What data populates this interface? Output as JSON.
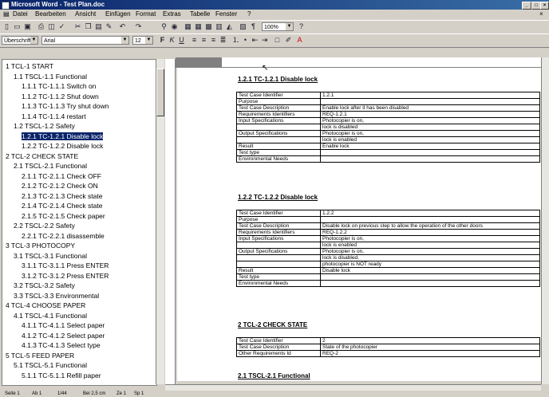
{
  "window": {
    "title": "Microsoft Word - Test Plan.doc"
  },
  "menu": [
    "Datei",
    "Bearbeiten",
    "Ansicht",
    "Einfügen",
    "Format",
    "Extras",
    "Tabelle",
    "Fenster",
    "?"
  ],
  "toolbar": {
    "style": "Überschrift",
    "font": "Arial",
    "size": "12",
    "zoom": "100%"
  },
  "docmap": [
    {
      "text": "1 TCL-1 START",
      "indent": 0
    },
    {
      "text": "1.1 TSCL-1.1 Functional",
      "indent": 1
    },
    {
      "text": "1.1.1 TC-1.1.1 Switch on",
      "indent": 2
    },
    {
      "text": "1.1.2 TC-1.1.2 Shut down",
      "indent": 2
    },
    {
      "text": "1.1.3 TC-1.1.3 Try shut down",
      "indent": 2
    },
    {
      "text": "1.1.4 TC-1.1.4 restart",
      "indent": 2
    },
    {
      "text": "1.2 TSCL-1.2 Safety",
      "indent": 1
    },
    {
      "text": "1.2.1 TC-1.2.1 Disable lock",
      "indent": 2,
      "selected": true
    },
    {
      "text": "1.2.2 TC-1.2.2 Disable lock",
      "indent": 2
    },
    {
      "text": "2 TCL-2 CHECK STATE",
      "indent": 0
    },
    {
      "text": "2.1 TSCL-2.1 Functional",
      "indent": 1
    },
    {
      "text": "2.1.1 TC-2.1.1 Check OFF",
      "indent": 2
    },
    {
      "text": "2.1.2 TC-2.1.2 Check ON",
      "indent": 2
    },
    {
      "text": "2.1.3 TC-2.1.3 Check state",
      "indent": 2
    },
    {
      "text": "2.1.4 TC-2.1.4 Check state",
      "indent": 2
    },
    {
      "text": "2.1.5 TC-2.1.5 Check paper",
      "indent": 2
    },
    {
      "text": "2.2 TSCL-2.2 Safety",
      "indent": 1
    },
    {
      "text": "2.2.1 TC-2.2.1 disassemble",
      "indent": 2
    },
    {
      "text": "3 TCL-3 PHOTOCOPY",
      "indent": 0
    },
    {
      "text": "3.1 TSCL-3.1 Functional",
      "indent": 1
    },
    {
      "text": "3.1.1 TC-3.1.1 Press ENTER",
      "indent": 2
    },
    {
      "text": "3.1.2 TC-3.1.2 Press ENTER",
      "indent": 2
    },
    {
      "text": "3.2 TSCL-3.2 Safety",
      "indent": 1
    },
    {
      "text": "3.3 TSCL-3.3 Environmental",
      "indent": 1
    },
    {
      "text": "4 TCL-4 CHOOSE PAPER",
      "indent": 0
    },
    {
      "text": "4.1 TSCL-4.1 Functional",
      "indent": 1
    },
    {
      "text": "4.1.1 TC-4.1.1 Select paper",
      "indent": 2
    },
    {
      "text": "4.1.2 TC-4.1.2 Select paper",
      "indent": 2
    },
    {
      "text": "4.1.3 TC-4.1.3 Select type",
      "indent": 2
    },
    {
      "text": "5 TCL-5 FEED PAPER",
      "indent": 0
    },
    {
      "text": "5.1 TSCL-5.1 Functional",
      "indent": 1
    },
    {
      "text": "5.1.1 TC-5.1.1 Refill paper",
      "indent": 2
    }
  ],
  "document": {
    "h1": "1.2.1 TC-1.2.1 Disable lock",
    "t1": [
      [
        "Test Case Identifier",
        "1.2.1"
      ],
      [
        "Purpose",
        ""
      ],
      [
        "Test Case Description",
        "Enable lock after it has been disabled"
      ],
      [
        "Requirements Identifiers",
        "REQ-1.2.1"
      ],
      [
        "Input Specifications",
        "Photocopier is on,"
      ],
      [
        "",
        "lock is disabled"
      ],
      [
        "Output Specifications",
        "Photocopier is on,"
      ],
      [
        "",
        "lock is enabled"
      ],
      [
        "Result",
        "Enable lock"
      ],
      [
        "Test type",
        ""
      ],
      [
        "Environmental Needs",
        ""
      ]
    ],
    "h2": "1.2.2 TC-1.2.2 Disable lock",
    "t2": [
      [
        "Test Case Identifier",
        "1.2.2"
      ],
      [
        "Purpose",
        ""
      ],
      [
        "Test Case Description",
        "Disable lock on previous step to allow the operation of the other doors"
      ],
      [
        "Requirements Identifiers",
        "REQ-1.2.2"
      ],
      [
        "Input Specifications",
        "Photocopier is on,"
      ],
      [
        "",
        "lock is enabled"
      ],
      [
        "Output Specifications",
        "Photocopier is on,"
      ],
      [
        "",
        "lock is disabled,"
      ],
      [
        "",
        "photocopier is NOT ready"
      ],
      [
        "Result",
        "Disable lock"
      ],
      [
        "Test type",
        ""
      ],
      [
        "Environmental Needs",
        ""
      ]
    ],
    "h3": "2 TCL-2 CHECK STATE",
    "t3": [
      [
        "Test Case Identifier",
        "2"
      ],
      [
        "Test Case Description",
        "State of the photocopier"
      ],
      [
        "Other Requirements Id",
        "REQ-2"
      ]
    ],
    "h4": "2.1 TSCL-2.1 Functional"
  },
  "status": {
    "page": "Seite 1",
    "section": "Ab 1",
    "pages": "1/44",
    "pos": "Bei 2,5 cm",
    "line": "Ze 1",
    "col": "Sp 1"
  }
}
